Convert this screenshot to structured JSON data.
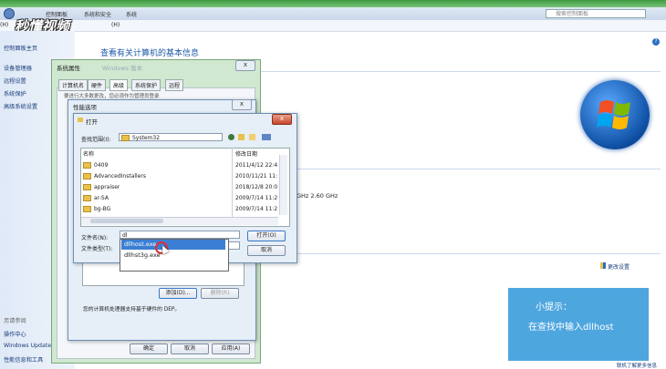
{
  "address": {
    "crumbs": [
      "控制面板",
      "系统和安全",
      "系统"
    ],
    "search_placeholder": "搜索控制面板"
  },
  "menu": {
    "left": "(H)",
    "right": "(H)"
  },
  "watermark": "秒懂视频",
  "left_pane": {
    "home": "控制面板主页",
    "links": [
      "设备管理器",
      "远程设置",
      "系统保护",
      "高级系统设置"
    ],
    "see_also": "另请参阅",
    "bottom_links": [
      "操作中心",
      "Windows Update",
      "性能信息和工具"
    ]
  },
  "main": {
    "title": "查看有关计算机的基本信息",
    "cpu_text": "GHz   2.60 GHz",
    "change_settings": "更改设置",
    "bottom_link": "联机了解更多信息"
  },
  "sys_props": {
    "title": "系统属性",
    "faded_title": "Windows 版本",
    "tabs": [
      "计算机名",
      "硬件",
      "高级",
      "系统保护",
      "远程"
    ],
    "note_line": "要进行大多数更改，您必须作为管理员登录",
    "ok": "确定",
    "cancel": "取消",
    "apply": "应用(A)"
  },
  "perf_opts": {
    "title": "性能选项",
    "dep_text": "您的计算机处理器支持基于硬件的 DEP。",
    "add_btn": "添加(D)...",
    "remove_btn": "删除(R)"
  },
  "open_dialog": {
    "title": "打开",
    "lookin_label": "查找范围(I):",
    "lookin_value": "System32",
    "col_name": "名称",
    "col_date": "修改日期",
    "files": [
      {
        "name": "0409",
        "date": "2011/4/12 22:4"
      },
      {
        "name": "AdvancedInstallers",
        "date": "2010/11/21 11:"
      },
      {
        "name": "appraiser",
        "date": "2018/12/8 20:0"
      },
      {
        "name": "ar-SA",
        "date": "2009/7/14 11:2"
      },
      {
        "name": "bg-BG",
        "date": "2009/7/14 11:2"
      }
    ],
    "filename_label": "文件名(N):",
    "filename_value": "dl",
    "filetype_label": "文件类型(T):",
    "open_btn": "打开(O)",
    "cancel_btn": "取消",
    "suggestions": [
      "dllhost.exe",
      "dllhst3g.exe"
    ]
  },
  "tip": {
    "title": "小提示：",
    "body": "在查找中输入dllhost"
  },
  "colors": {
    "accent": "#1e5aa8",
    "tip_bg": "#4ea6de",
    "highlight": "#3b7fd4"
  }
}
